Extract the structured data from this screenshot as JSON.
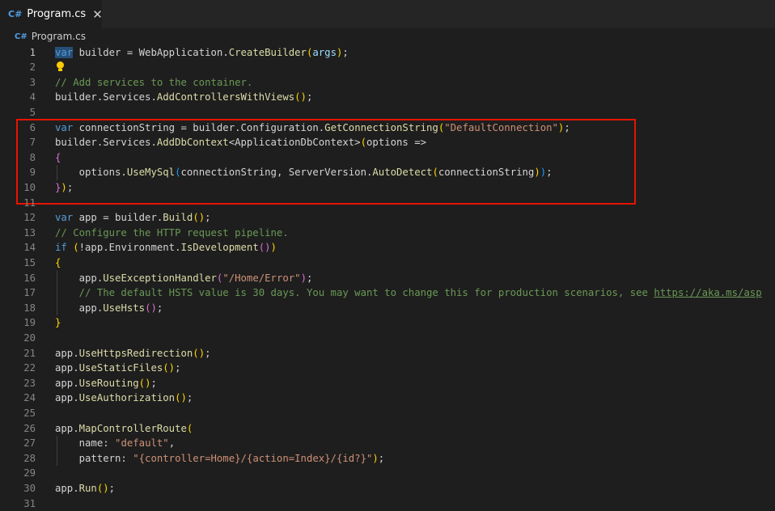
{
  "tab": {
    "lang_icon": "C#",
    "title": "Program.cs",
    "close_glyph": "✕"
  },
  "breadcrumb": {
    "lang_icon": "C#",
    "file": "Program.cs"
  },
  "lines": [
    {
      "n": "1",
      "tokens": [
        [
          "var",
          "kw sel"
        ],
        [
          " builder = ",
          "pn"
        ],
        [
          "WebApplication",
          "pn"
        ],
        [
          ".",
          "pn"
        ],
        [
          "CreateBuilder",
          "fn"
        ],
        [
          "(",
          "b1"
        ],
        [
          "args",
          "var"
        ],
        [
          ")",
          "b1"
        ],
        [
          ";",
          "pn"
        ]
      ]
    },
    {
      "n": "2",
      "tokens": [],
      "bulb": true
    },
    {
      "n": "3",
      "tokens": [
        [
          "// Add services to the container.",
          "cm"
        ]
      ]
    },
    {
      "n": "4",
      "tokens": [
        [
          "builder.Services.",
          "pn"
        ],
        [
          "AddControllersWithViews",
          "fn"
        ],
        [
          "()",
          "b1"
        ],
        [
          ";",
          "pn"
        ]
      ]
    },
    {
      "n": "5",
      "tokens": []
    },
    {
      "n": "6",
      "tokens": [
        [
          "var",
          "kw"
        ],
        [
          " connectionString = builder.Configuration.",
          "pn"
        ],
        [
          "GetConnectionString",
          "fn"
        ],
        [
          "(",
          "b1"
        ],
        [
          "\"DefaultConnection\"",
          "str"
        ],
        [
          ")",
          "b1"
        ],
        [
          ";",
          "pn"
        ]
      ]
    },
    {
      "n": "7",
      "tokens": [
        [
          "builder.Services.",
          "pn"
        ],
        [
          "AddDbContext",
          "fn"
        ],
        [
          "<ApplicationDbContext>",
          "pn"
        ],
        [
          "(",
          "b1"
        ],
        [
          "options =>",
          "pn"
        ]
      ]
    },
    {
      "n": "8",
      "tokens": [
        [
          "{",
          "b2"
        ]
      ]
    },
    {
      "n": "9",
      "tokens": [
        [
          "    options.",
          "pn"
        ],
        [
          "UseMySql",
          "fn"
        ],
        [
          "(",
          "b3"
        ],
        [
          "connectionString, ServerVersion.",
          "pn"
        ],
        [
          "AutoDetect",
          "fn"
        ],
        [
          "(",
          "b1"
        ],
        [
          "connectionString",
          "pn"
        ],
        [
          ")",
          "b1"
        ],
        [
          ")",
          "b3"
        ],
        [
          ";",
          "pn"
        ]
      ]
    },
    {
      "n": "10",
      "tokens": [
        [
          "}",
          "b2"
        ],
        [
          ")",
          "b1"
        ],
        [
          ";",
          "pn"
        ]
      ]
    },
    {
      "n": "11",
      "tokens": []
    },
    {
      "n": "12",
      "tokens": [
        [
          "var",
          "kw"
        ],
        [
          " app = builder.",
          "pn"
        ],
        [
          "Build",
          "fn"
        ],
        [
          "()",
          "b1"
        ],
        [
          ";",
          "pn"
        ]
      ]
    },
    {
      "n": "13",
      "tokens": [
        [
          "// Configure the HTTP request pipeline.",
          "cm"
        ]
      ]
    },
    {
      "n": "14",
      "tokens": [
        [
          "if",
          "kw"
        ],
        [
          " ",
          "pn"
        ],
        [
          "(",
          "b1"
        ],
        [
          "!app.Environment.",
          "pn"
        ],
        [
          "IsDevelopment",
          "fn"
        ],
        [
          "()",
          "b2"
        ],
        [
          ")",
          "b1"
        ]
      ]
    },
    {
      "n": "15",
      "tokens": [
        [
          "{",
          "b1"
        ]
      ]
    },
    {
      "n": "16",
      "tokens": [
        [
          "    app.",
          "pn"
        ],
        [
          "UseExceptionHandler",
          "fn"
        ],
        [
          "(",
          "b2"
        ],
        [
          "\"/Home/Error\"",
          "str"
        ],
        [
          ")",
          "b2"
        ],
        [
          ";",
          "pn"
        ]
      ]
    },
    {
      "n": "17",
      "tokens": [
        [
          "    // The default HSTS value is 30 days. You may want to change this for production scenarios, see ",
          "cm"
        ],
        [
          "https://aka.ms/asp",
          "link"
        ]
      ]
    },
    {
      "n": "18",
      "tokens": [
        [
          "    app.",
          "pn"
        ],
        [
          "UseHsts",
          "fn"
        ],
        [
          "()",
          "b2"
        ],
        [
          ";",
          "pn"
        ]
      ]
    },
    {
      "n": "19",
      "tokens": [
        [
          "}",
          "b1"
        ]
      ]
    },
    {
      "n": "20",
      "tokens": []
    },
    {
      "n": "21",
      "tokens": [
        [
          "app.",
          "pn"
        ],
        [
          "UseHttpsRedirection",
          "fn"
        ],
        [
          "()",
          "b1"
        ],
        [
          ";",
          "pn"
        ]
      ]
    },
    {
      "n": "22",
      "tokens": [
        [
          "app.",
          "pn"
        ],
        [
          "UseStaticFiles",
          "fn"
        ],
        [
          "()",
          "b1"
        ],
        [
          ";",
          "pn"
        ]
      ]
    },
    {
      "n": "23",
      "tokens": [
        [
          "app.",
          "pn"
        ],
        [
          "UseRouting",
          "fn"
        ],
        [
          "()",
          "b1"
        ],
        [
          ";",
          "pn"
        ]
      ]
    },
    {
      "n": "24",
      "tokens": [
        [
          "app.",
          "pn"
        ],
        [
          "UseAuthorization",
          "fn"
        ],
        [
          "()",
          "b1"
        ],
        [
          ";",
          "pn"
        ]
      ]
    },
    {
      "n": "25",
      "tokens": []
    },
    {
      "n": "26",
      "tokens": [
        [
          "app.",
          "pn"
        ],
        [
          "MapControllerRoute",
          "fn"
        ],
        [
          "(",
          "b1"
        ]
      ]
    },
    {
      "n": "27",
      "tokens": [
        [
          "    name: ",
          "pn"
        ],
        [
          "\"default\"",
          "str"
        ],
        [
          ",",
          "pn"
        ]
      ]
    },
    {
      "n": "28",
      "tokens": [
        [
          "    pattern: ",
          "pn"
        ],
        [
          "\"{controller=Home}/{action=Index}/{id?}\"",
          "str"
        ],
        [
          ")",
          "b1"
        ],
        [
          ";",
          "pn"
        ]
      ]
    },
    {
      "n": "29",
      "tokens": []
    },
    {
      "n": "30",
      "tokens": [
        [
          "app.",
          "pn"
        ],
        [
          "Run",
          "fn"
        ],
        [
          "()",
          "b1"
        ],
        [
          ";",
          "pn"
        ]
      ]
    },
    {
      "n": "31",
      "tokens": []
    }
  ],
  "active_line": "1",
  "colors": {
    "keyword": "#569cd6",
    "function": "#dcdcaa",
    "string": "#ce9178",
    "comment": "#6a9955",
    "highlight_box": "#e51400"
  }
}
